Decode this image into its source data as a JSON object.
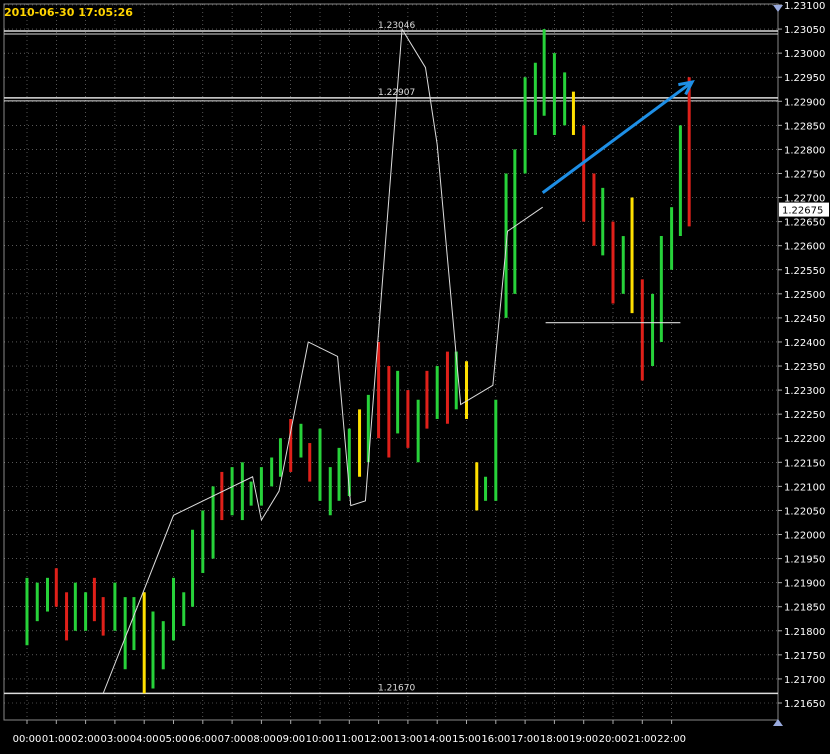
{
  "timestamp": "2010-06-30 17:05:26",
  "colors": {
    "background": "#000000",
    "grid": "#ffffff",
    "up": "#27d23a",
    "down": "#e0201a",
    "neutral": "#ffe000",
    "zigzag": "#dddddd",
    "level": "#dddddd",
    "arrow": "#1e8fe6",
    "axis_text": "#ffffff",
    "current_price_bg": "#ffffff",
    "current_price_text": "#000000"
  },
  "chart_data": {
    "type": "bar",
    "instrument_timeframe": "hourly-like OHLC bars (approx. 20-minute bars)",
    "x_ticks": [
      "00:00",
      "01:00",
      "02:00",
      "03:00",
      "04:00",
      "05:00",
      "06:00",
      "07:00",
      "08:00",
      "09:00",
      "10:00",
      "11:00",
      "12:00",
      "13:00",
      "14:00",
      "15:00",
      "16:00",
      "17:00",
      "18:00",
      "19:00",
      "20:00",
      "21:00",
      "22:00"
    ],
    "y_ticks": [
      "1.23100",
      "1.23050",
      "1.23000",
      "1.22950",
      "1.22900",
      "1.22850",
      "1.22800",
      "1.22750",
      "1.22700",
      "1.22650",
      "1.22600",
      "1.22550",
      "1.22500",
      "1.22450",
      "1.22400",
      "1.22350",
      "1.22300",
      "1.22250",
      "1.22200",
      "1.22150",
      "1.22100",
      "1.22050",
      "1.22000",
      "1.21950",
      "1.21900",
      "1.21850",
      "1.21800",
      "1.21750",
      "1.21700",
      "1.21650"
    ],
    "ylim": [
      1.2162,
      1.231
    ],
    "xlim_hours": [
      -0.3,
      22.8
    ],
    "horizontal_levels": [
      {
        "label": "1.23046",
        "value": 1.23046
      },
      {
        "label": "1.22907",
        "value": 1.22907
      },
      {
        "label": "1.21670",
        "value": 1.2167
      }
    ],
    "current_price": "1.22675",
    "current_price_value": 1.22675,
    "bars": [
      {
        "t": 0.0,
        "high": 1.2191,
        "low": 1.2177,
        "color": "up"
      },
      {
        "t": 0.35,
        "high": 1.219,
        "low": 1.2182,
        "color": "up"
      },
      {
        "t": 0.7,
        "high": 1.2191,
        "low": 1.2184,
        "color": "up"
      },
      {
        "t": 1.0,
        "high": 1.2193,
        "low": 1.2185,
        "color": "down"
      },
      {
        "t": 1.35,
        "high": 1.2188,
        "low": 1.2178,
        "color": "down"
      },
      {
        "t": 1.65,
        "high": 1.219,
        "low": 1.218,
        "color": "up"
      },
      {
        "t": 2.0,
        "high": 1.2188,
        "low": 1.218,
        "color": "up"
      },
      {
        "t": 2.3,
        "high": 1.2191,
        "low": 1.2182,
        "color": "down"
      },
      {
        "t": 2.6,
        "high": 1.2187,
        "low": 1.2179,
        "color": "down"
      },
      {
        "t": 3.0,
        "high": 1.219,
        "low": 1.218,
        "color": "up"
      },
      {
        "t": 3.35,
        "high": 1.2187,
        "low": 1.2172,
        "color": "up"
      },
      {
        "t": 3.65,
        "high": 1.2187,
        "low": 1.2176,
        "color": "up"
      },
      {
        "t": 4.0,
        "high": 1.2188,
        "low": 1.2167,
        "color": "neutral"
      },
      {
        "t": 4.3,
        "high": 1.2184,
        "low": 1.2168,
        "color": "up"
      },
      {
        "t": 4.65,
        "high": 1.2182,
        "low": 1.2172,
        "color": "up"
      },
      {
        "t": 5.0,
        "high": 1.2191,
        "low": 1.2178,
        "color": "up"
      },
      {
        "t": 5.35,
        "high": 1.2188,
        "low": 1.2181,
        "color": "up"
      },
      {
        "t": 5.65,
        "high": 1.2201,
        "low": 1.2185,
        "color": "up"
      },
      {
        "t": 6.0,
        "high": 1.2205,
        "low": 1.2192,
        "color": "up"
      },
      {
        "t": 6.35,
        "high": 1.221,
        "low": 1.2195,
        "color": "up"
      },
      {
        "t": 6.65,
        "high": 1.2213,
        "low": 1.2203,
        "color": "down"
      },
      {
        "t": 7.0,
        "high": 1.2214,
        "low": 1.2204,
        "color": "up"
      },
      {
        "t": 7.35,
        "high": 1.2215,
        "low": 1.2203,
        "color": "up"
      },
      {
        "t": 7.65,
        "high": 1.2211,
        "low": 1.2206,
        "color": "up"
      },
      {
        "t": 8.0,
        "high": 1.2214,
        "low": 1.2206,
        "color": "up"
      },
      {
        "t": 8.35,
        "high": 1.2216,
        "low": 1.221,
        "color": "up"
      },
      {
        "t": 8.65,
        "high": 1.222,
        "low": 1.2212,
        "color": "up"
      },
      {
        "t": 9.0,
        "high": 1.2224,
        "low": 1.2213,
        "color": "down"
      },
      {
        "t": 9.35,
        "high": 1.2223,
        "low": 1.2216,
        "color": "up"
      },
      {
        "t": 9.65,
        "high": 1.2219,
        "low": 1.2211,
        "color": "down"
      },
      {
        "t": 10.0,
        "high": 1.2222,
        "low": 1.2207,
        "color": "up"
      },
      {
        "t": 10.35,
        "high": 1.2214,
        "low": 1.2204,
        "color": "up"
      },
      {
        "t": 10.65,
        "high": 1.2218,
        "low": 1.2207,
        "color": "up"
      },
      {
        "t": 11.0,
        "high": 1.2222,
        "low": 1.2208,
        "color": "up"
      },
      {
        "t": 11.35,
        "high": 1.2226,
        "low": 1.2212,
        "color": "neutral"
      },
      {
        "t": 11.65,
        "high": 1.2229,
        "low": 1.2215,
        "color": "up"
      },
      {
        "t": 12.0,
        "high": 1.224,
        "low": 1.222,
        "color": "down"
      },
      {
        "t": 12.35,
        "high": 1.2235,
        "low": 1.2216,
        "color": "down"
      },
      {
        "t": 12.65,
        "high": 1.2234,
        "low": 1.2221,
        "color": "up"
      },
      {
        "t": 13.0,
        "high": 1.223,
        "low": 1.2218,
        "color": "down"
      },
      {
        "t": 13.35,
        "high": 1.2228,
        "low": 1.2215,
        "color": "up"
      },
      {
        "t": 13.65,
        "high": 1.2234,
        "low": 1.2222,
        "color": "down"
      },
      {
        "t": 14.0,
        "high": 1.2235,
        "low": 1.2224,
        "color": "up"
      },
      {
        "t": 14.35,
        "high": 1.2238,
        "low": 1.2223,
        "color": "down"
      },
      {
        "t": 14.65,
        "high": 1.2238,
        "low": 1.2226,
        "color": "up"
      },
      {
        "t": 15.0,
        "high": 1.2236,
        "low": 1.2224,
        "color": "neutral"
      },
      {
        "t": 15.35,
        "high": 1.2215,
        "low": 1.2205,
        "color": "neutral"
      },
      {
        "t": 15.65,
        "high": 1.2212,
        "low": 1.2207,
        "color": "up"
      },
      {
        "t": 16.0,
        "high": 1.2228,
        "low": 1.2207,
        "color": "up"
      },
      {
        "t": 16.35,
        "high": 1.2275,
        "low": 1.2245,
        "color": "up"
      },
      {
        "t": 16.65,
        "high": 1.228,
        "low": 1.225,
        "color": "up"
      },
      {
        "t": 17.0,
        "high": 1.2295,
        "low": 1.2275,
        "color": "up"
      },
      {
        "t": 17.35,
        "high": 1.2298,
        "low": 1.2283,
        "color": "up"
      },
      {
        "t": 17.65,
        "high": 1.2305,
        "low": 1.2287,
        "color": "up"
      },
      {
        "t": 18.0,
        "high": 1.23,
        "low": 1.2283,
        "color": "up"
      },
      {
        "t": 18.35,
        "high": 1.2296,
        "low": 1.2285,
        "color": "up"
      },
      {
        "t": 18.65,
        "high": 1.2292,
        "low": 1.2283,
        "color": "neutral"
      },
      {
        "t": 19.0,
        "high": 1.2285,
        "low": 1.2265,
        "color": "down"
      },
      {
        "t": 19.35,
        "high": 1.2275,
        "low": 1.226,
        "color": "down"
      },
      {
        "t": 19.65,
        "high": 1.2272,
        "low": 1.2258,
        "color": "up"
      },
      {
        "t": 20.0,
        "high": 1.2265,
        "low": 1.2248,
        "color": "down"
      },
      {
        "t": 20.35,
        "high": 1.2262,
        "low": 1.225,
        "color": "up"
      },
      {
        "t": 20.65,
        "high": 1.227,
        "low": 1.2246,
        "color": "neutral"
      },
      {
        "t": 21.0,
        "high": 1.2253,
        "low": 1.2232,
        "color": "down"
      },
      {
        "t": 21.35,
        "high": 1.225,
        "low": 1.2235,
        "color": "up"
      },
      {
        "t": 21.65,
        "high": 1.2262,
        "low": 1.224,
        "color": "up"
      },
      {
        "t": 22.0,
        "high": 1.2268,
        "low": 1.2255,
        "color": "up"
      },
      {
        "t": 22.3,
        "high": 1.2285,
        "low": 1.2262,
        "color": "up"
      },
      {
        "t": 22.6,
        "high": 1.2295,
        "low": 1.2264,
        "color": "down"
      }
    ],
    "zigzag": [
      [
        2.6,
        1.2167
      ],
      [
        5.0,
        1.2204
      ],
      [
        7.7,
        1.2212
      ],
      [
        8.0,
        1.2203
      ],
      [
        8.6,
        1.2209
      ],
      [
        9.6,
        1.224
      ],
      [
        10.6,
        1.2237
      ],
      [
        11.05,
        1.2206
      ],
      [
        11.55,
        1.2207
      ],
      [
        12.8,
        1.2305
      ],
      [
        13.6,
        1.2297
      ],
      [
        14.0,
        1.2281
      ],
      [
        14.8,
        1.2227
      ],
      [
        15.9,
        1.2231
      ],
      [
        16.4,
        1.2263
      ],
      [
        17.6,
        1.2268
      ]
    ]
  }
}
